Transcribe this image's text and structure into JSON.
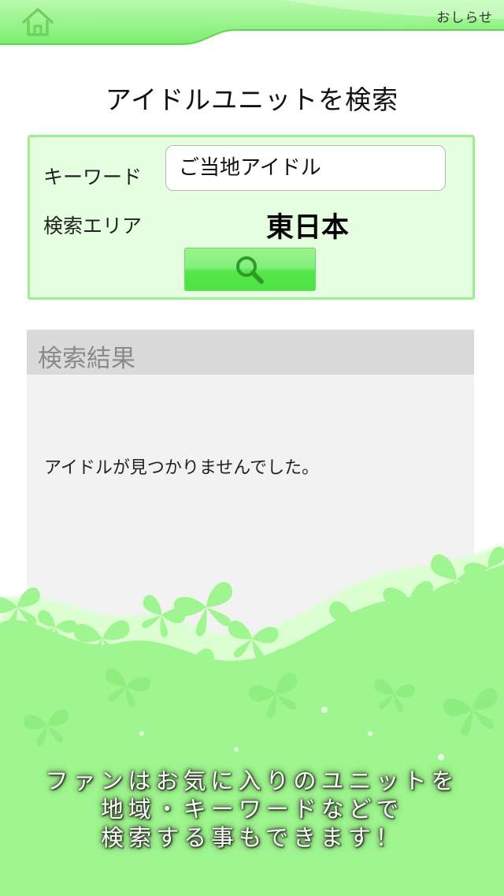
{
  "header": {
    "home_icon": "home-icon",
    "notice_label": "おしらせ",
    "colors": {
      "bar": "#8af07e",
      "bar_light": "#c8fbbf"
    }
  },
  "title": "アイドルユニットを検索",
  "search": {
    "keyword_label": "キーワード",
    "keyword_value": "ご当地アイドル",
    "area_label": "検索エリア",
    "area_value": "東日本",
    "button_icon": "magnifier-icon",
    "colors": {
      "panel_bg": "#e6ffe0",
      "panel_border": "#9bf08f",
      "button": "#56e54a"
    }
  },
  "results": {
    "header": "検索結果",
    "empty_message": "アイドルが見つかりませんでした。"
  },
  "promo": {
    "line1": "ファンはお気に入りのユニットを",
    "line2": "地域・キーワードなどで",
    "line3": "検索する事もできます！",
    "colors": {
      "butterfly": "#9ff58f"
    }
  }
}
